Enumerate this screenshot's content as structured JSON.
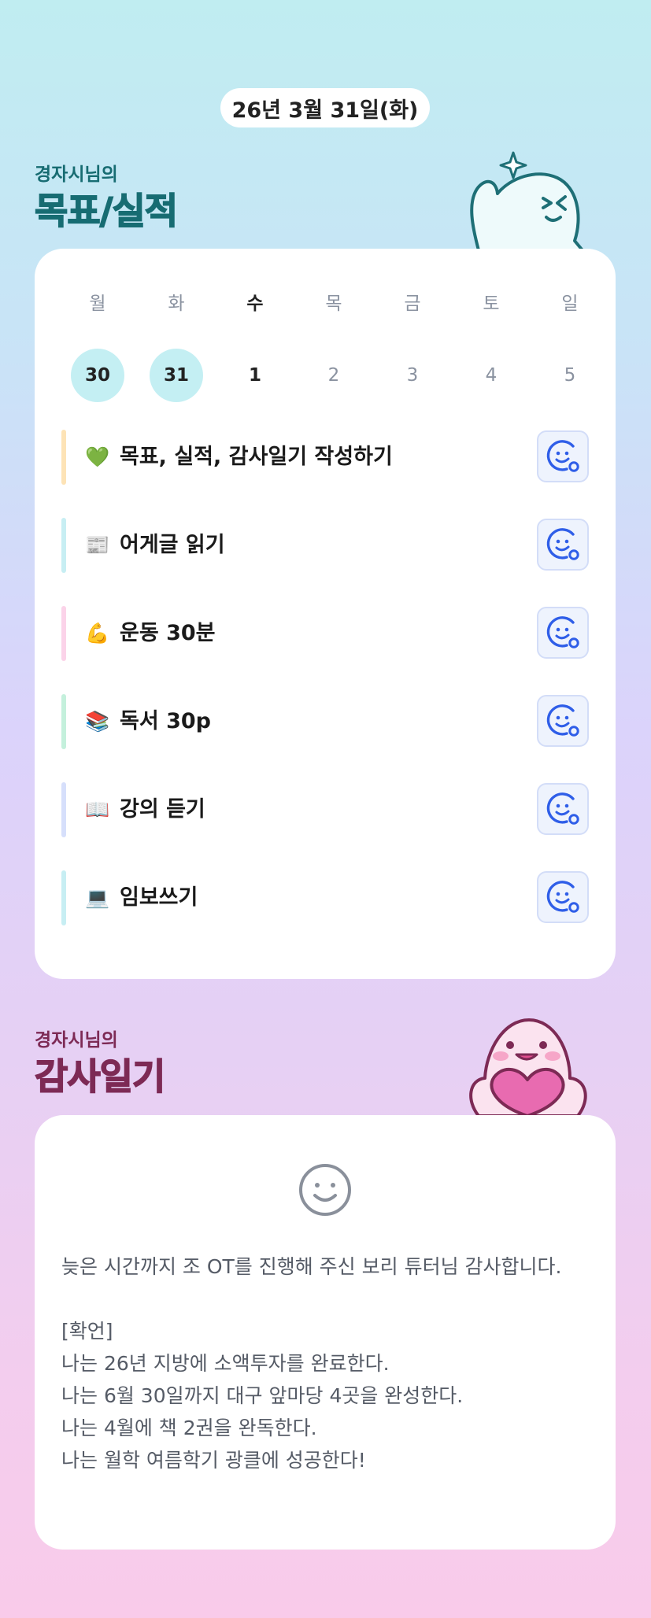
{
  "header": {
    "date": "26년 3월 31일(화)"
  },
  "goals_section": {
    "subtitle": "경자시님의",
    "title": "목표/실적"
  },
  "week": {
    "days": [
      "월",
      "화",
      "수",
      "목",
      "금",
      "토",
      "일"
    ],
    "dates": [
      "30",
      "31",
      "1",
      "2",
      "3",
      "4",
      "5"
    ],
    "today_index": 2,
    "filled_indices": [
      0,
      1
    ]
  },
  "goals": [
    {
      "emoji": "💚",
      "label": "목표, 실적, 감사일기 작성하기",
      "bar_color": "#fde3b6"
    },
    {
      "emoji": "📰",
      "label": "어게글 읽기",
      "bar_color": "#c7eef3"
    },
    {
      "emoji": "💪",
      "label": "운동 30분",
      "bar_color": "#fbd3e9"
    },
    {
      "emoji": "📚",
      "label": "독서 30p",
      "bar_color": "#c4f0dc"
    },
    {
      "emoji": "📖",
      "label": "강의 듣기",
      "bar_color": "#d6dffb"
    },
    {
      "emoji": "💻",
      "label": "임보쓰기",
      "bar_color": "#c7eef3"
    }
  ],
  "diary_section": {
    "subtitle": "경자시님의",
    "title": "감사일기"
  },
  "diary": {
    "icon": "smile-icon",
    "text": "늦은 시간까지 조 OT를 진행해 주신 보리 튜터님 감사합니다.\n\n[확언]\n나는 26년 지방에 소액투자를 완료한다.\n나는 6월 30일까지 대구 앞마당 4곳을 완성한다.\n나는 4월에 책 2권을 완독한다.\n나는 월학 여름학기 광클에 성공한다!"
  },
  "colors": {
    "goals_title": "#176c72",
    "diary_title": "#7d2a55",
    "date_highlight": "#c4eff3",
    "button_icon": "#2f5ee8"
  }
}
